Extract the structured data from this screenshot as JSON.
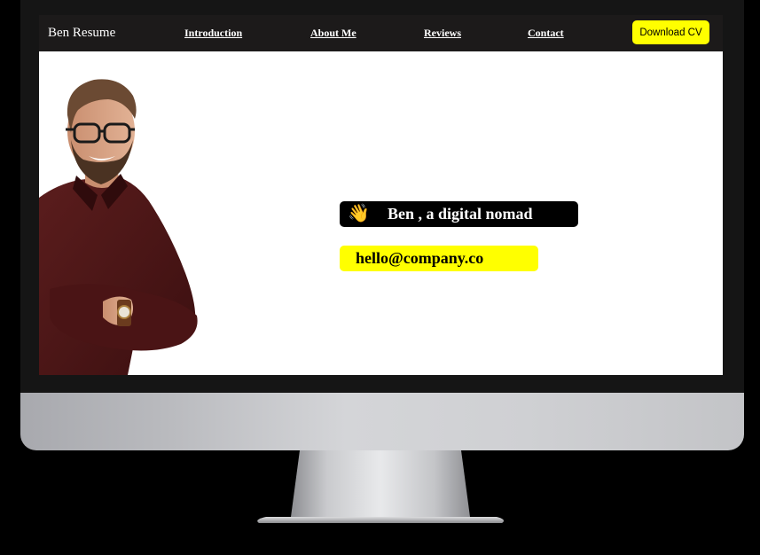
{
  "navbar": {
    "brand": "Ben Resume",
    "links": [
      {
        "label": "Introduction"
      },
      {
        "label": "About Me"
      },
      {
        "label": "Reviews"
      },
      {
        "label": "Contact"
      }
    ],
    "cta_label": "Download CV"
  },
  "hero": {
    "intro_text": "Ben , a digital nomad",
    "wave_icon": "waving-hand-icon",
    "email": "hello@company.co"
  },
  "colors": {
    "accent": "#ffff00",
    "navbar_bg": "#1c1a1a",
    "badge_dark": "#000000"
  }
}
